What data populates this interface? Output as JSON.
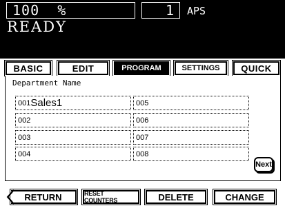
{
  "lcd": {
    "zoom": "100  %",
    "copies": "1",
    "paper": "APS",
    "status": "READY"
  },
  "tabs": [
    {
      "label": "BASIC",
      "active": false
    },
    {
      "label": "EDIT",
      "active": false
    },
    {
      "label": "PROGRAM",
      "active": true
    },
    {
      "label": "SETTINGS",
      "active": false
    },
    {
      "label": "QUICK",
      "active": false
    }
  ],
  "department": {
    "title": "Department Name",
    "fields": [
      {
        "code": "001",
        "name": "Sales1"
      },
      {
        "code": "002",
        "name": ""
      },
      {
        "code": "003",
        "name": ""
      },
      {
        "code": "004",
        "name": ""
      },
      {
        "code": "005",
        "name": ""
      },
      {
        "code": "006",
        "name": ""
      },
      {
        "code": "007",
        "name": ""
      },
      {
        "code": "008",
        "name": ""
      }
    ],
    "next_label": "Next"
  },
  "buttons": {
    "return": "RETURN",
    "reset": "RESET COUNTERS",
    "delete": "DELETE",
    "change": "CHANGE"
  }
}
